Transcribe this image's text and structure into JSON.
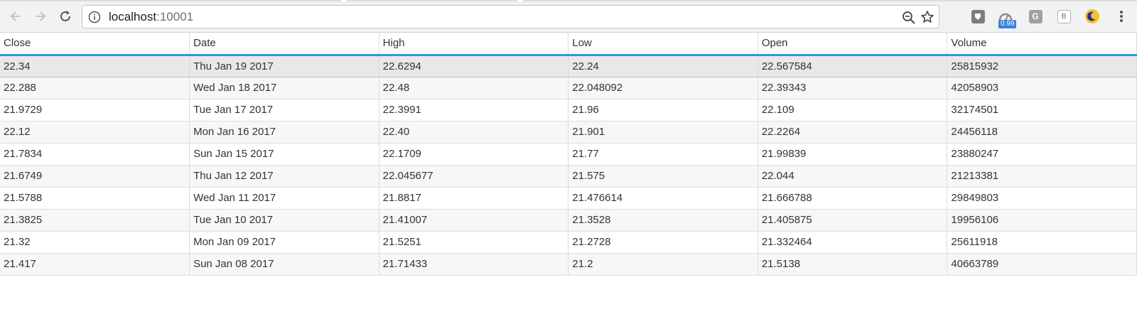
{
  "browser": {
    "url_host": "localhost",
    "url_port": ":10001",
    "extensions": [
      {
        "name": "shield-extension-icon",
        "label": ""
      },
      {
        "name": "speed-extension-icon",
        "badge": "0.99"
      },
      {
        "name": "g-extension-icon",
        "label": "G"
      },
      {
        "name": "bi-extension-icon",
        "label": "B"
      },
      {
        "name": "moon-extension-icon",
        "label": ""
      }
    ],
    "colors": {
      "accent": "#2b9ad6",
      "badge": "#3d7fd6"
    }
  },
  "table": {
    "columns": [
      "Close",
      "Date",
      "High",
      "Low",
      "Open",
      "Volume"
    ],
    "rows": [
      [
        "22.34",
        "Thu Jan 19 2017",
        "22.6294",
        "22.24",
        "22.567584",
        "25815932"
      ],
      [
        "22.288",
        "Wed Jan 18 2017",
        "22.48",
        "22.048092",
        "22.39343",
        "42058903"
      ],
      [
        "21.9729",
        "Tue Jan 17 2017",
        "22.3991",
        "21.96",
        "22.109",
        "32174501"
      ],
      [
        "22.12",
        "Mon Jan 16 2017",
        "22.40",
        "21.901",
        "22.2264",
        "24456118"
      ],
      [
        "21.7834",
        "Sun Jan 15 2017",
        "22.1709",
        "21.77",
        "21.99839",
        "23880247"
      ],
      [
        "21.6749",
        "Thu Jan 12 2017",
        "22.045677",
        "21.575",
        "22.044",
        "21213381"
      ],
      [
        "21.5788",
        "Wed Jan 11 2017",
        "21.8817",
        "21.476614",
        "21.666788",
        "29849803"
      ],
      [
        "21.3825",
        "Tue Jan 10 2017",
        "21.41007",
        "21.3528",
        "21.405875",
        "19956106"
      ],
      [
        "21.32",
        "Mon Jan 09 2017",
        "21.5251",
        "21.2728",
        "21.332464",
        "25611918"
      ],
      [
        "21.417",
        "Sun Jan 08 2017",
        "21.71433",
        "21.2",
        "21.5138",
        "40663789"
      ]
    ],
    "selected_row": 0
  }
}
